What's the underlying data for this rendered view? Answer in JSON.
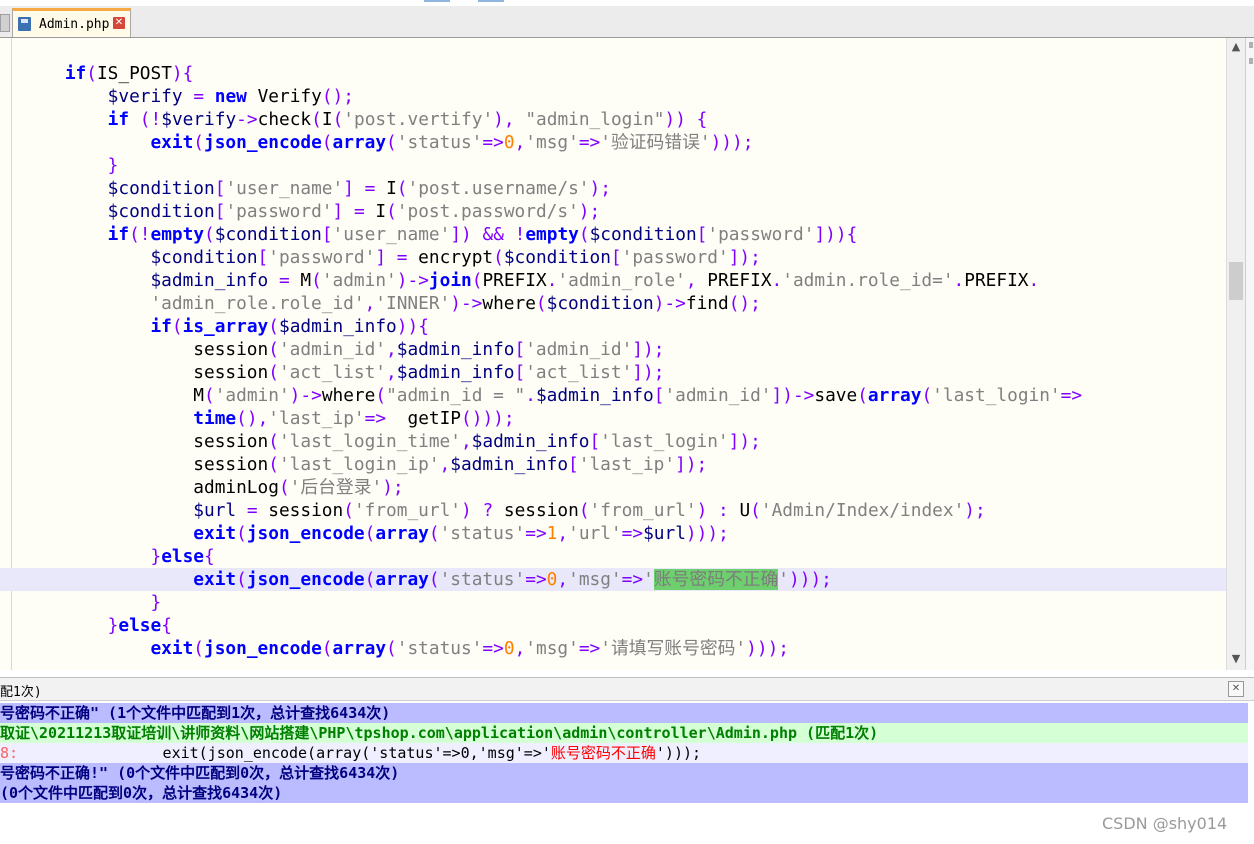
{
  "tab": {
    "filename": "Admin.php",
    "close_glyph": "✕"
  },
  "code_lines": [
    "    if(IS_POST){",
    "        $verify = new Verify();",
    "        if (!$verify->check(I('post.vertify'), \"admin_login\")) {",
    "            exit(json_encode(array('status'=>0,'msg'=>'验证码错误')));",
    "        }",
    "        $condition['user_name'] = I('post.username/s');",
    "        $condition['password'] = I('post.password/s');",
    "        if(!empty($condition['user_name']) && !empty($condition['password'])){",
    "            $condition['password'] = encrypt($condition['password']);",
    "            $admin_info = M('admin')->join(PREFIX.'admin_role', PREFIX.'admin.role_id='.PREFIX.",
    "            'admin_role.role_id','INNER')->where($condition)->find();",
    "            if(is_array($admin_info)){",
    "                session('admin_id',$admin_info['admin_id']);",
    "                session('act_list',$admin_info['act_list']);",
    "                M('admin')->where(\"admin_id = \".$admin_info['admin_id'])->save(array('last_login'=>",
    "                time(),'last_ip'=>  getIP()));",
    "                session('last_login_time',$admin_info['last_login']);",
    "                session('last_login_ip',$admin_info['last_ip']);",
    "                adminLog('后台登录');",
    "                $url = session('from_url') ? session('from_url') : U('Admin/Index/index');",
    "                exit(json_encode(array('status'=>1,'url'=>$url)));",
    "            }else{",
    "                exit(json_encode(array('status'=>0,'msg'=>'账号密码不正确')));",
    "            }",
    "        }else{",
    "            exit(json_encode(array('status'=>0,'msg'=>'请填写账号密码')));"
  ],
  "highlighted_text": "账号密码不正确",
  "current_line_index": 22,
  "results_panel": {
    "title": "配1次)",
    "close_glyph": "✕",
    "lines": [
      {
        "kind": "search",
        "text": "号密码不正确\" (1个文件中匹配到1次，总计查找6434次)"
      },
      {
        "kind": "file",
        "text": "取证\\20211213取证培训\\讲师资料\\网站搭建\\PHP\\tpshop.com\\application\\admin\\controller\\Admin.php (匹配1次)"
      },
      {
        "kind": "hit",
        "line_no": "8:",
        "prefix": "                exit(json_encode(array('status'=>0,'msg'=>'",
        "match": "账号密码不正确",
        "suffix": "')));"
      },
      {
        "kind": "search",
        "text": "号密码不正确!\" (0个文件中匹配到0次，总计查找6434次)"
      },
      {
        "kind": "search",
        "text": "(0个文件中匹配到0次，总计查找6434次)"
      }
    ]
  },
  "watermark": "CSDN @shy014",
  "scroll": {
    "up_glyph": "▲",
    "down_glyph": "▼"
  },
  "colors": {
    "keyword": "#0000ff",
    "string": "#808080",
    "variable": "#000080",
    "operator": "#8000ff",
    "number": "#ff8000",
    "match_highlight": "#6dcf6d",
    "current_line": "#e8e8fa",
    "search_result_bg": "#bbbbff",
    "file_result_bg": "#d5ffd5"
  }
}
